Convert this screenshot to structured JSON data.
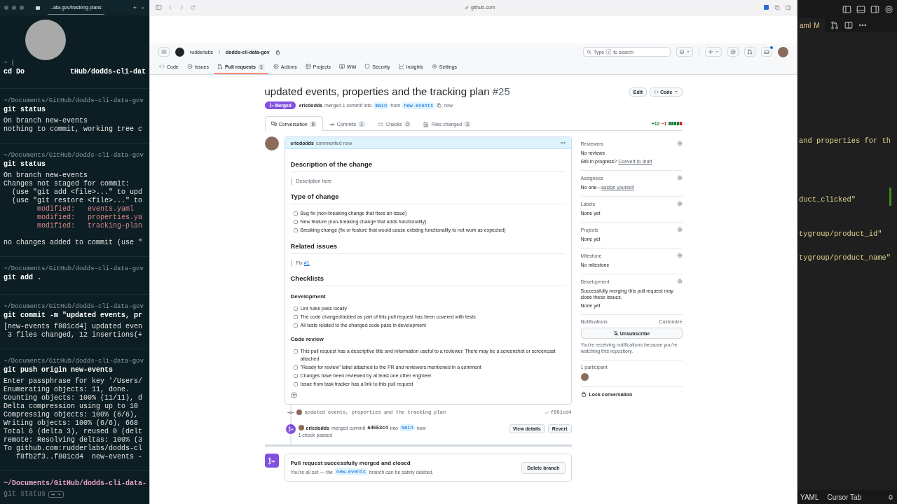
{
  "terminal": {
    "tab": "..ata-gov/tracking-plans",
    "new_tab": "+",
    "blocks": [
      {
        "prompt": "~ (",
        "command": "cd Do",
        "command_tail": "tHub/dodds-cli-dat"
      },
      {
        "prompt": "~/Documents/GitHub/dodds-cli-data-gov",
        "command": "git status",
        "output": [
          {
            "kind": "plain",
            "text": "On branch new-events"
          },
          {
            "kind": "plain",
            "text": "nothing to commit, working tree c"
          }
        ]
      },
      {
        "prompt": "~/Documents/GitHub/dodds-cli-data-gov",
        "command": "git status",
        "output": [
          {
            "kind": "plain",
            "text": "On branch new-events"
          },
          {
            "kind": "plain",
            "text": "Changes not staged for commit:"
          },
          {
            "kind": "plain",
            "text": "  (use \"git add <file>...\" to upd"
          },
          {
            "kind": "plain",
            "text": "  (use \"git restore <file>...\" to"
          },
          {
            "kind": "modified",
            "text": "        modified:   events.yaml"
          },
          {
            "kind": "modified",
            "text": "        modified:   properties.ya"
          },
          {
            "kind": "modified",
            "text": "        modified:   tracking-plan"
          },
          {
            "kind": "plain",
            "text": "no changes added to commit (use \""
          }
        ]
      },
      {
        "prompt": "~/Documents/GitHub/dodds-cli-data-gov",
        "command": "git add ."
      },
      {
        "prompt": "~/Documents/GitHub/dodds-cli-data-gov",
        "command": "git commit -m \"updated events, pr",
        "output": [
          {
            "kind": "plain",
            "text": "[new-events f801cd4] updated even"
          },
          {
            "kind": "plain",
            "text": " 3 files changed, 12 insertions(+"
          }
        ]
      },
      {
        "prompt": "~/Documents/GitHub/dodds-cli-data-gov",
        "command": "git push origin new-events",
        "output": [
          {
            "kind": "plain",
            "text": "Enter passphrase for key '/Users/"
          },
          {
            "kind": "plain",
            "text": "Enumerating objects: 11, done."
          },
          {
            "kind": "plain",
            "text": "Counting objects: 100% (11/11), d"
          },
          {
            "kind": "plain",
            "text": "Delta compression using up to 10"
          },
          {
            "kind": "plain",
            "text": "Compressing objects: 100% (6/6),"
          },
          {
            "kind": "plain",
            "text": "Writing objects: 100% (6/6), 668"
          },
          {
            "kind": "plain",
            "text": "Total 6 (delta 3), reused 0 (delt"
          },
          {
            "kind": "plain",
            "text": "remote: Resolving deltas: 100% (3"
          },
          {
            "kind": "plain",
            "text": "To github.com:rudderlabs/dodds-cl"
          },
          {
            "kind": "plain",
            "text": "   f8fb2f3..f801cd4  new-events -"
          }
        ]
      }
    ],
    "current": {
      "prompt": "~/Documents/GitHub/dodds-cli-data-",
      "suggestion": "git status"
    }
  },
  "browser": {
    "url": "github.com",
    "header": {
      "owner": "rudderlabs",
      "separator": "/",
      "repo": "dodds-cli-data-gov",
      "search_before": "Type",
      "search_key": "/",
      "search_after": "to search"
    },
    "repo_tabs": [
      {
        "label": "Code",
        "selected": false
      },
      {
        "label": "Issues",
        "selected": false
      },
      {
        "label": "Pull requests",
        "count": "1",
        "selected": true
      },
      {
        "label": "Actions",
        "selected": false
      },
      {
        "label": "Projects",
        "selected": false
      },
      {
        "label": "Wiki",
        "selected": false
      },
      {
        "label": "Security",
        "selected": false
      },
      {
        "label": "Insights",
        "selected": false
      },
      {
        "label": "Settings",
        "selected": false
      }
    ],
    "pr": {
      "title": "updated events, properties and the tracking plan",
      "number": "#25",
      "edit": "Edit",
      "code": "Code",
      "state": "Merged",
      "author": "ericdodds",
      "action": "merged 1 commit into",
      "base": "main",
      "from": "from",
      "head": "new-events",
      "time": "now"
    },
    "pr_tabs": [
      {
        "label": "Conversation",
        "count": "0",
        "selected": true
      },
      {
        "label": "Commits",
        "count": "1",
        "selected": false
      },
      {
        "label": "Checks",
        "count": "0",
        "selected": false
      },
      {
        "label": "Files changed",
        "count": "3",
        "selected": false
      }
    ],
    "diffstat": {
      "added": "+12",
      "removed": "−1"
    },
    "comment": {
      "author": "ericdodds",
      "action": "commented now",
      "body": [
        {
          "kind": "h2",
          "text": "Description of the change"
        },
        {
          "kind": "quote",
          "text": "Description here"
        },
        {
          "kind": "h2",
          "text": "Type of change"
        },
        {
          "kind": "task",
          "text": "Bug fix (non-breaking change that fixes an issue)",
          "checked": false
        },
        {
          "kind": "task",
          "text": "New feature (non-breaking change that adds functionality)",
          "checked": false
        },
        {
          "kind": "task",
          "text": "Breaking change (fix or feature that would cause existing functionality to not work as expected)",
          "checked": false
        },
        {
          "kind": "h2",
          "text": "Related issues"
        },
        {
          "kind": "quote",
          "text": "Fix",
          "link": "#1"
        },
        {
          "kind": "h2",
          "text": "Checklists"
        },
        {
          "kind": "h3",
          "text": "Development"
        },
        {
          "kind": "task",
          "text": "Lint rules pass locally",
          "checked": false
        },
        {
          "kind": "task",
          "text": "The code changed/added as part of this pull request has been covered with tests",
          "checked": false
        },
        {
          "kind": "task",
          "text": "All tests related to the changed code pass in development",
          "checked": false
        },
        {
          "kind": "h3",
          "text": "Code review"
        },
        {
          "kind": "task",
          "text": "This pull request has a descriptive title and information useful to a reviewer. There may be a screenshot or screencast attached",
          "checked": false
        },
        {
          "kind": "task",
          "text": "\"Ready for review\" label attached to the PR and reviewers mentioned in a comment",
          "checked": false
        },
        {
          "kind": "task",
          "text": "Changes have been reviewed by at least one other engineer",
          "checked": false
        },
        {
          "kind": "task",
          "text": "Issue from task tracker has a link to this pull request",
          "checked": false
        }
      ]
    },
    "timeline": {
      "commit": {
        "message": "updated events, properties and the tracking plan",
        "sha": "f801cd4"
      },
      "merge": {
        "author": "ericdodds",
        "action": "merged commit",
        "sha": "a4653c4",
        "into": "into",
        "branch": "main",
        "time": "now",
        "checks": "1 check passed",
        "buttons": [
          "View details",
          "Revert"
        ]
      },
      "merged_box": {
        "title": "Pull request successfully merged and closed",
        "before": "You’re all set — the",
        "branch": "new-events",
        "after": "branch can be safely deleted.",
        "button": "Delete branch"
      }
    },
    "sidebar": [
      {
        "kind": "field",
        "title": "Reviewers",
        "lines": [
          {
            "text": "No reviews"
          },
          {
            "text": "Still in progress? ",
            "link": "Convert to draft"
          }
        ]
      },
      {
        "kind": "field",
        "title": "Assignees",
        "lines": [
          {
            "text": "No one—",
            "link": "assign yourself"
          }
        ]
      },
      {
        "kind": "field",
        "title": "Labels",
        "lines": [
          {
            "text": "None yet"
          }
        ]
      },
      {
        "kind": "field",
        "title": "Projects",
        "lines": [
          {
            "text": "None yet"
          }
        ]
      },
      {
        "kind": "field",
        "title": "Milestone",
        "lines": [
          {
            "text": "No milestone"
          }
        ]
      },
      {
        "kind": "field",
        "title": "Development",
        "lines": [
          {
            "text": "Successfully merging this pull request may close these issues."
          },
          {
            "text": "None yet"
          }
        ]
      },
      {
        "kind": "notifications",
        "title": "Notifications",
        "action": "Customize",
        "button": "Unsubscribe",
        "note": "You’re receiving notifications because you’re watching this repository."
      },
      {
        "kind": "participants",
        "title": "1 participant"
      },
      {
        "kind": "lock",
        "label": "Lock conversation"
      }
    ]
  },
  "editor": {
    "tab": "aml",
    "tab_status": "M",
    "lines": [
      {
        "text": "and properties for th"
      },
      {
        "text": "duct_clicked\""
      },
      {
        "text": "tygroup/product_id\""
      },
      {
        "text": "tygroup/product_name\""
      }
    ],
    "status": [
      "YAML",
      "Cursor Tab"
    ]
  }
}
